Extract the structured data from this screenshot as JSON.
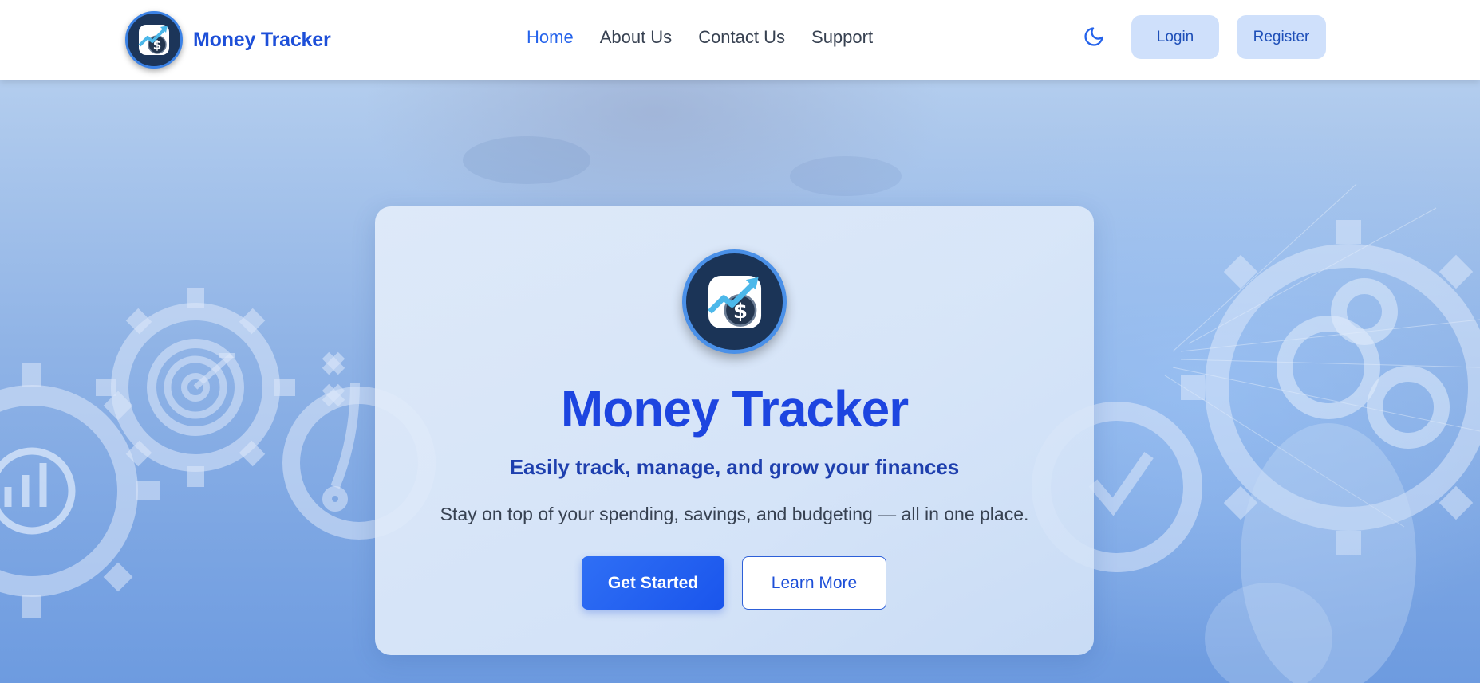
{
  "header": {
    "brand_name": "Money Tracker",
    "nav": [
      "Home",
      "About Us",
      "Contact Us",
      "Support"
    ],
    "active_nav": "Home",
    "theme_icon": "moon-icon",
    "login_label": "Login",
    "register_label": "Register"
  },
  "hero": {
    "title": "Money Tracker",
    "subtitle": "Easily track, manage, and grow your finances",
    "description": "Stay on top of your spending, savings, and budgeting — all in one place.",
    "primary_cta": "Get Started",
    "secondary_cta": "Learn More"
  },
  "colors": {
    "brand_blue": "#1d4fd8",
    "title_blue": "#1d45e0",
    "primary_button": "#2563eb",
    "pill_button_bg": "#cfe0fb",
    "logo_dark": "#1b3457"
  },
  "icons": {
    "logo": "money-tracker-logo-icon",
    "background": [
      "gear-icon",
      "target-icon",
      "bar-chart-icon",
      "strategy-icon",
      "checkmark-icon"
    ]
  }
}
